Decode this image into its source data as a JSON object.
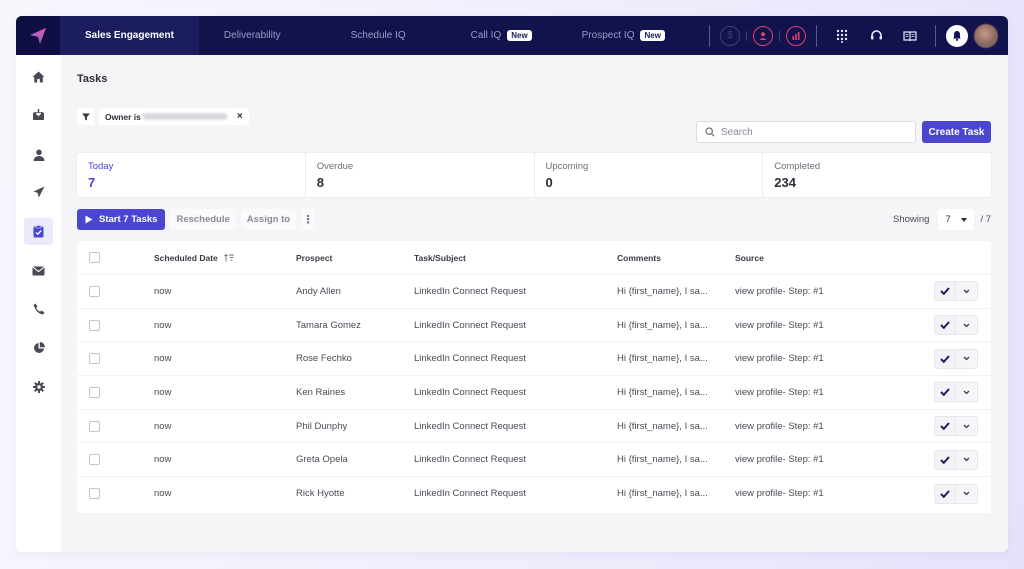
{
  "topnav": {
    "tabs": [
      {
        "label": "Sales Engagement",
        "active": true,
        "badge": null
      },
      {
        "label": "Deliverability",
        "active": false,
        "badge": null
      },
      {
        "label": "Schedule IQ",
        "active": false,
        "badge": null
      },
      {
        "label": "Call IQ",
        "active": false,
        "badge": "New"
      },
      {
        "label": "Prospect IQ",
        "active": false,
        "badge": "New"
      }
    ],
    "badge_label": "New",
    "icons": [
      "dollar-icon",
      "user-circle-icon",
      "chart-circle-icon",
      "dialpad-icon",
      "headset-icon",
      "book-icon",
      "bell-icon",
      "avatar"
    ],
    "colors": {
      "bg": "#12124d",
      "active_tab": "#1b1d5e",
      "pink": "#e2406e"
    }
  },
  "sidebar": {
    "items": [
      {
        "name": "home",
        "active": false
      },
      {
        "name": "inbox",
        "active": false
      },
      {
        "name": "prospects",
        "active": false
      },
      {
        "name": "sequences",
        "active": false
      },
      {
        "name": "tasks",
        "active": true
      },
      {
        "name": "email",
        "active": false
      },
      {
        "name": "calls",
        "active": false
      },
      {
        "name": "reports",
        "active": false
      },
      {
        "name": "settings",
        "active": false
      }
    ]
  },
  "page": {
    "title": "Tasks",
    "filter": {
      "label": "Owner is",
      "value_redacted": true
    },
    "search": {
      "placeholder": "Search",
      "value": ""
    },
    "create_button": "Create Task",
    "accent": "#4b46cf"
  },
  "stats": [
    {
      "label": "Today",
      "value": "7",
      "active": true
    },
    {
      "label": "Overdue",
      "value": "8",
      "active": false
    },
    {
      "label": "Upcoming",
      "value": "0",
      "active": false
    },
    {
      "label": "Completed",
      "value": "234",
      "active": false
    }
  ],
  "actions": {
    "start": "Start 7 Tasks",
    "reschedule": "Reschedule",
    "assign": "Assign to",
    "showing_label": "Showing",
    "page_size": "7",
    "total": "/ 7"
  },
  "table": {
    "columns": [
      "Scheduled Date",
      "Prospect",
      "Task/Subject",
      "Comments",
      "Source"
    ],
    "rows": [
      {
        "date": "now",
        "prospect": "Andy Allen",
        "task": "LinkedIn Connect Request",
        "comments": "Hi {first_name}, I sa...",
        "source": "view profile- Step: #1"
      },
      {
        "date": "now",
        "prospect": "Tamara Gomez",
        "task": "LinkedIn Connect Request",
        "comments": "Hi {first_name}, I sa...",
        "source": "view profile- Step: #1"
      },
      {
        "date": "now",
        "prospect": "Rose Fechko",
        "task": "LinkedIn Connect Request",
        "comments": "Hi {first_name}, I sa...",
        "source": "view profile- Step: #1"
      },
      {
        "date": "now",
        "prospect": "Ken Raines",
        "task": "LinkedIn Connect Request",
        "comments": "Hi {first_name}, I sa...",
        "source": "view profile- Step: #1"
      },
      {
        "date": "now",
        "prospect": "Phil Dunphy",
        "task": "LinkedIn Connect Request",
        "comments": "Hi {first_name}, I sa...",
        "source": "view profile- Step: #1"
      },
      {
        "date": "now",
        "prospect": "Greta Opela",
        "task": "LinkedIn Connect Request",
        "comments": "Hi {first_name}, I sa...",
        "source": "view profile- Step: #1"
      },
      {
        "date": "now",
        "prospect": "Rick Hyotte",
        "task": "LinkedIn Connect Request",
        "comments": "Hi {first_name}, I sa...",
        "source": "view profile- Step: #1"
      }
    ]
  }
}
